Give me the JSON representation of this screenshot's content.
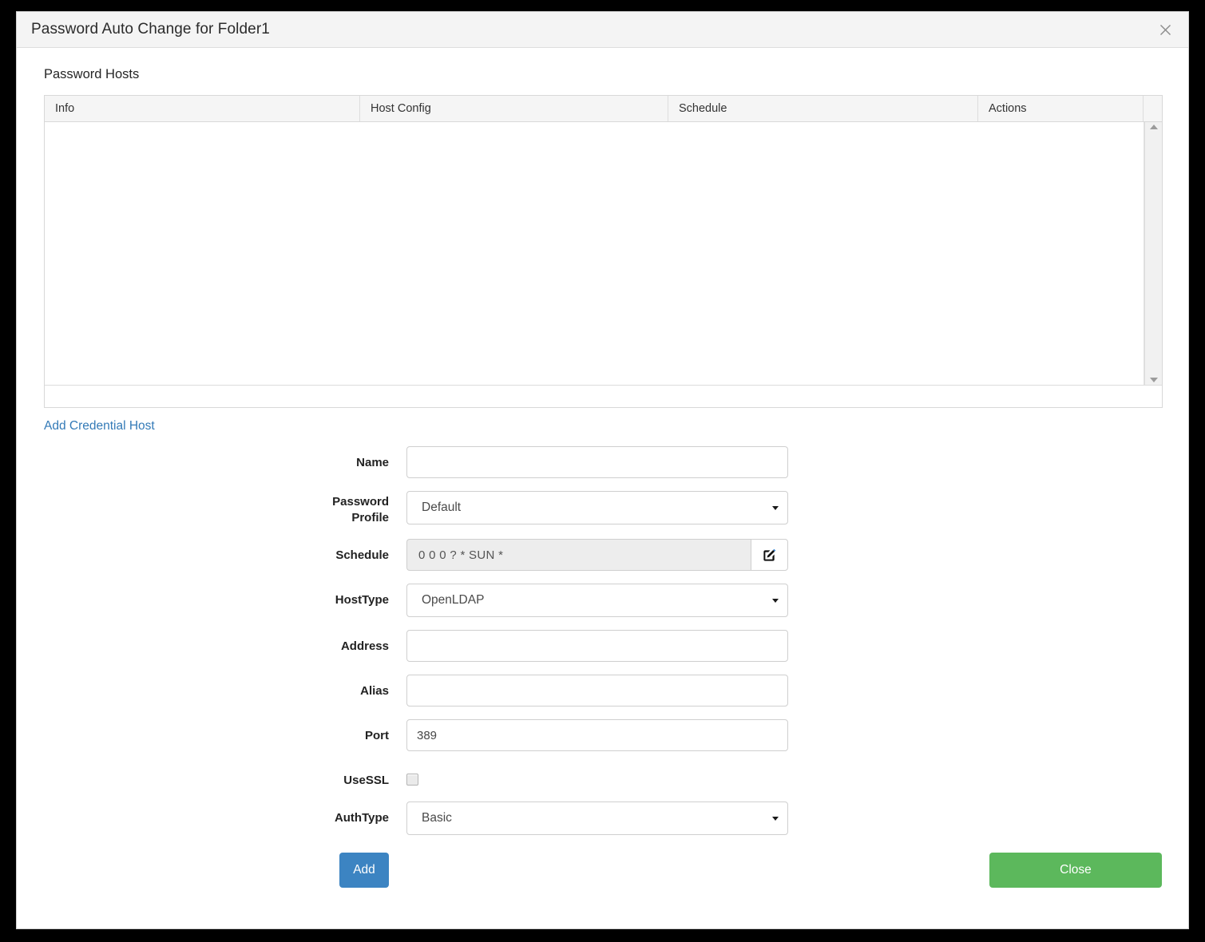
{
  "dialog": {
    "title": "Password Auto Change for Folder1",
    "close_icon": "close-icon"
  },
  "grid": {
    "section_title": "Password Hosts",
    "columns": [
      "Info",
      "Host Config",
      "Schedule",
      "Actions"
    ],
    "rows": [],
    "scrollbar": {
      "up": "scroll-up-arrow",
      "down": "scroll-down-arrow"
    }
  },
  "links": {
    "add_credential_host": "Add Credential Host"
  },
  "form": {
    "name": {
      "label": "Name",
      "value": "",
      "placeholder": ""
    },
    "password_profile": {
      "label_line1": "Password",
      "label_line2": "Profile",
      "value": "Default"
    },
    "schedule": {
      "label": "Schedule",
      "value": "0 0 0 ? * SUN *",
      "edit_icon": "edit-pencil-square-icon"
    },
    "host_type": {
      "label": "HostType",
      "value": "OpenLDAP"
    },
    "address": {
      "label": "Address",
      "value": "",
      "placeholder": ""
    },
    "alias": {
      "label": "Alias",
      "value": "",
      "placeholder": ""
    },
    "port": {
      "label": "Port",
      "value": "389",
      "placeholder": ""
    },
    "use_ssl": {
      "label": "UseSSL",
      "checked": false
    },
    "auth_type": {
      "label": "AuthType",
      "value": "Basic"
    }
  },
  "buttons": {
    "add": "Add",
    "close": "Close"
  },
  "colors": {
    "link": "#337ab7",
    "add_button": "#3c84c2",
    "close_button": "#5cb85c",
    "header_bg": "#f4f4f4",
    "grid_header_bg": "#f5f5f5",
    "disabled_input_bg": "#ededed"
  }
}
